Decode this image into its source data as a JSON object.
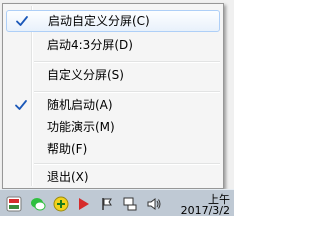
{
  "menu": {
    "items": [
      {
        "label": "启动自定义分屏(C)",
        "checked": true,
        "highlighted": true
      },
      {
        "label": "启动4:3分屏(D)",
        "checked": false,
        "highlighted": false
      },
      {
        "label": "自定义分屏(S)",
        "checked": false,
        "highlighted": false
      },
      {
        "label": "随机启动(A)",
        "checked": true,
        "highlighted": false
      },
      {
        "label": "功能演示(M)",
        "checked": false,
        "highlighted": false
      },
      {
        "label": "帮助(F)",
        "checked": false,
        "highlighted": false
      },
      {
        "label": "退出(X)",
        "checked": false,
        "highlighted": false
      }
    ]
  },
  "taskbar": {
    "clock_time": "上午",
    "clock_date": "2017/3/2"
  },
  "colors": {
    "check": "#1b58b8",
    "highlight_border": "#aecff7",
    "taskbar": "#bfc9d4"
  }
}
